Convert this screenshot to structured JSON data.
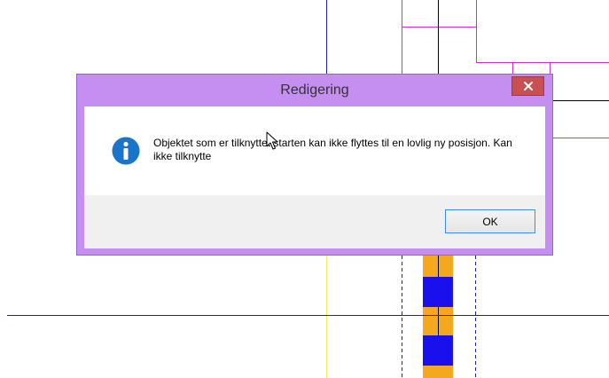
{
  "dialog": {
    "title": "Redigering",
    "message": "Objektet som er tilknyttet starten kan ikke flyttes til en lovlig ny posisjon. Kan ikke tilknytte",
    "ok_label": "OK",
    "icon": "info-icon",
    "close_icon": "close-icon"
  },
  "colors": {
    "title_bar": "#c48ff0",
    "close_button": "#c75050",
    "info_icon": "#1a74c9",
    "button_area": "#f0f0f0",
    "ok_border": "#3c8ee0",
    "map_blue_line": "#2222aa",
    "map_magenta_line": "#cc33cc",
    "map_black_line": "#000000",
    "map_yellow_line": "#eeee55",
    "road_orange": "#f4a81d",
    "road_blue": "#1a10ee"
  }
}
